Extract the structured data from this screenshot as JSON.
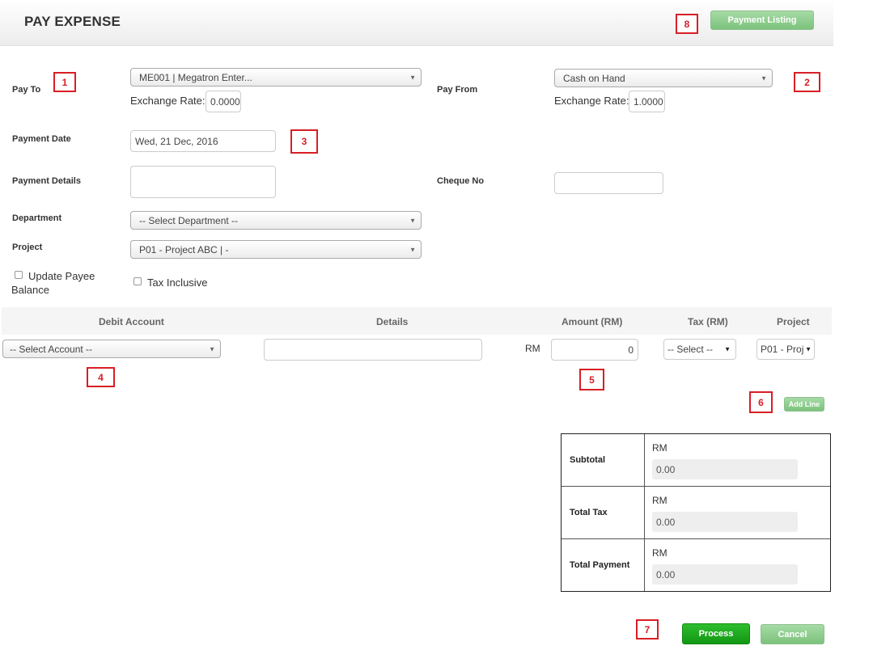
{
  "header": {
    "title": "PAY EXPENSE",
    "listing_button": "Payment Listing"
  },
  "markers": [
    "1",
    "2",
    "3",
    "4",
    "5",
    "6",
    "7",
    "8"
  ],
  "form": {
    "pay_to_label": "Pay To",
    "pay_to_value": "ME001 | Megatron Enter...",
    "exchange_rate_label": "Exchange Rate:",
    "pay_to_rate": "0.0000",
    "pay_from_label": "Pay From",
    "pay_from_value": "Cash on Hand",
    "pay_from_rate": "1.0000",
    "payment_date_label": "Payment Date",
    "payment_date_value": "Wed, 21 Dec, 2016",
    "payment_details_label": "Payment Details",
    "cheque_no_label": "Cheque No",
    "department_label": "Department",
    "department_value": "-- Select Department --",
    "project_label": "Project",
    "project_value": "P01 - Project ABC | -",
    "update_payee_label_1": "Update Payee",
    "update_payee_label_2": "Balance",
    "tax_inclusive_label": "Tax Inclusive"
  },
  "lines": {
    "columns": [
      "Debit Account",
      "Details",
      "Amount (RM)",
      "Tax (RM)",
      "Project"
    ],
    "account_value": "-- Select Account --",
    "currency": "RM",
    "amount_value": "0",
    "tax_value": "-- Select --",
    "project_value": "P01 - Proj",
    "add_line_button": "Add Line"
  },
  "summary": {
    "currency": "RM",
    "rows": [
      {
        "label": "Subtotal",
        "value": "0.00"
      },
      {
        "label": "Total Tax",
        "value": "0.00"
      },
      {
        "label": "Total Payment",
        "value": "0.00"
      }
    ]
  },
  "actions": {
    "process": "Process",
    "cancel": "Cancel"
  },
  "colors": {
    "marker": "#d81e25",
    "button_green": "#7cc27c",
    "process_green": "#139713"
  }
}
